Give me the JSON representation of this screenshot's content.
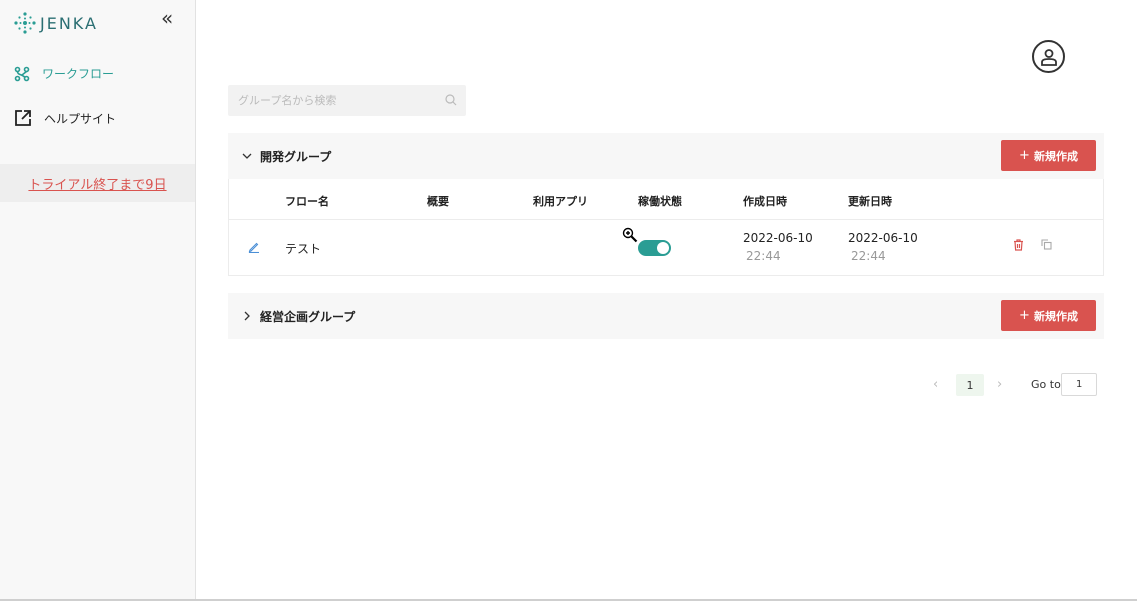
{
  "app": {
    "brand": "JENKA",
    "brand_color": "#2a9d94"
  },
  "sidebar": {
    "collapse_icon": "double-chevron-left-icon",
    "items": [
      {
        "label": "ワークフロー",
        "icon": "workflow-icon",
        "active": true
      },
      {
        "label": "ヘルプサイト",
        "icon": "external-link-icon",
        "active": false
      }
    ],
    "trial_text": "トライアル終了まで9日"
  },
  "header": {
    "avatar_icon": "user-account-icon"
  },
  "search": {
    "placeholder": "グループ名から検索",
    "value": ""
  },
  "groups": [
    {
      "name": "開発グループ",
      "expanded": true,
      "new_button_label": "新規作成",
      "columns": [
        "フロー名",
        "概要",
        "利用アプリ",
        "稼働状態",
        "作成日時",
        "更新日時"
      ],
      "rows": [
        {
          "flow_name": "テスト",
          "summary": "",
          "apps": "",
          "active": true,
          "created_date": "2022-06-10",
          "created_time": "22:44",
          "updated_date": "2022-06-10",
          "updated_time": "22:44"
        }
      ]
    },
    {
      "name": "経営企画グループ",
      "expanded": false,
      "new_button_label": "新規作成"
    }
  ],
  "pagination": {
    "current_page": "1",
    "goto_label": "Go to",
    "goto_value": "1"
  },
  "colors": {
    "accent": "#2a9d94",
    "danger": "#d9534f"
  }
}
